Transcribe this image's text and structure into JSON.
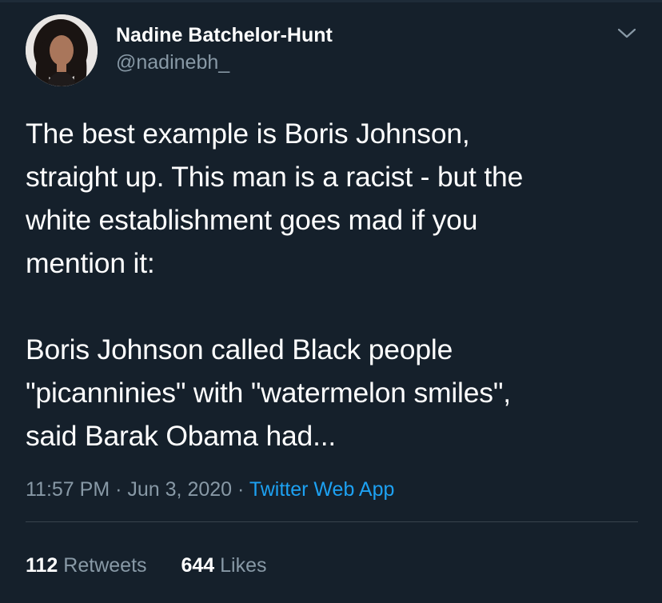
{
  "tweet": {
    "author": {
      "display_name": "Nadine Batchelor-Hunt",
      "handle": "@nadinebh_"
    },
    "text": "The best example is Boris Johnson,\nstraight up. This man is a racist - but the\nwhite establishment goes mad if you\nmention it:\n\nBoris Johnson called Black people\n\"picanninies\" with \"watermelon smiles\",\nsaid Barak Obama had...",
    "time": "11:57 PM",
    "separator": "·",
    "date": "Jun 3, 2020",
    "source": "Twitter Web App",
    "stats": {
      "retweets_count": "112",
      "retweets_label": "Retweets",
      "likes_count": "644",
      "likes_label": "Likes"
    }
  },
  "icons": {
    "more": "chevron-down-icon"
  },
  "colors": {
    "background": "#15202b",
    "primary_text": "#ffffff",
    "secondary_text": "#8899a6",
    "link": "#1da1f2",
    "divider": "#38444d"
  }
}
